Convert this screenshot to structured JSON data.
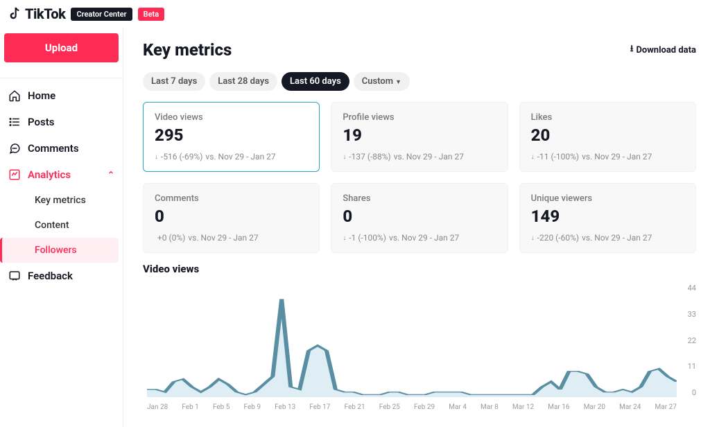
{
  "header": {
    "brand": "TikTok",
    "center_badge": "Creator Center",
    "beta_badge": "Beta"
  },
  "sidebar": {
    "upload_label": "Upload",
    "items": [
      {
        "id": "home",
        "label": "Home"
      },
      {
        "id": "posts",
        "label": "Posts"
      },
      {
        "id": "comments",
        "label": "Comments"
      },
      {
        "id": "analytics",
        "label": "Analytics",
        "active": true,
        "children": [
          {
            "id": "key-metrics",
            "label": "Key metrics"
          },
          {
            "id": "content",
            "label": "Content"
          },
          {
            "id": "followers",
            "label": "Followers",
            "active": true
          }
        ]
      },
      {
        "id": "feedback",
        "label": "Feedback"
      }
    ]
  },
  "page": {
    "title": "Key metrics",
    "download_label": "Download data",
    "tabs": [
      {
        "label": "Last 7 days"
      },
      {
        "label": "Last 28 days"
      },
      {
        "label": "Last 60 days",
        "active": true
      },
      {
        "label": "Custom",
        "dropdown": true
      }
    ],
    "cards": [
      {
        "label": "Video views",
        "value": "295",
        "delta": "-516 (-69%)",
        "vs": "vs. Nov 29 - Jan 27",
        "dir": "down",
        "selected": true
      },
      {
        "label": "Profile views",
        "value": "19",
        "delta": "-137 (-88%)",
        "vs": "vs. Nov 29 - Jan 27",
        "dir": "down"
      },
      {
        "label": "Likes",
        "value": "20",
        "delta": "-11 (-100%)",
        "vs": "vs. Nov 29 - Jan 27",
        "dir": "down"
      },
      {
        "label": "Comments",
        "value": "0",
        "delta": "+0 (0%)",
        "vs": "vs. Nov 29 - Jan 27",
        "dir": "flat"
      },
      {
        "label": "Shares",
        "value": "0",
        "delta": "-1 (-100%)",
        "vs": "vs. Nov 29 - Jan 27",
        "dir": "down"
      },
      {
        "label": "Unique viewers",
        "value": "149",
        "delta": "-220 (-60%)",
        "vs": "vs. Nov 29 - Jan 27",
        "dir": "down"
      }
    ],
    "chart_title": "Video views"
  },
  "chart_data": {
    "type": "line",
    "title": "Video views",
    "xlabel": "",
    "ylabel": "",
    "ylim": [
      0,
      44
    ],
    "y_ticks": [
      0,
      11,
      22,
      33,
      44
    ],
    "x_ticks": [
      "Jan 28",
      "Feb 1",
      "Feb 5",
      "Feb 9",
      "Feb 13",
      "Feb 17",
      "Feb 21",
      "Feb 25",
      "Feb 29",
      "Mar 4",
      "Mar 8",
      "Mar 12",
      "Mar 16",
      "Mar 20",
      "Mar 24",
      "Mar 27"
    ],
    "x": [
      0,
      1,
      2,
      3,
      4,
      5,
      6,
      7,
      8,
      9,
      10,
      11,
      12,
      13,
      14,
      15,
      16,
      17,
      18,
      19,
      20,
      21,
      22,
      23,
      24,
      25,
      26,
      27,
      28,
      29,
      30,
      31,
      32,
      33,
      34,
      35,
      36,
      37,
      38,
      39,
      40,
      41,
      42,
      43,
      44,
      45,
      46,
      47,
      48,
      49,
      50,
      51,
      52,
      53,
      54,
      55,
      56,
      57,
      58,
      59
    ],
    "values": [
      3,
      3,
      2,
      6,
      7,
      4,
      2,
      4,
      7,
      5,
      2,
      1,
      2,
      5,
      8,
      38,
      4,
      3,
      18,
      20,
      18,
      3,
      2,
      2,
      1,
      1,
      1,
      2,
      2,
      1,
      1,
      1,
      2,
      2,
      2,
      2,
      1,
      1,
      1,
      1,
      1,
      1,
      1,
      1,
      4,
      6,
      3,
      10,
      10,
      9,
      4,
      2,
      2,
      3,
      2,
      4,
      10,
      11,
      8,
      6
    ]
  }
}
